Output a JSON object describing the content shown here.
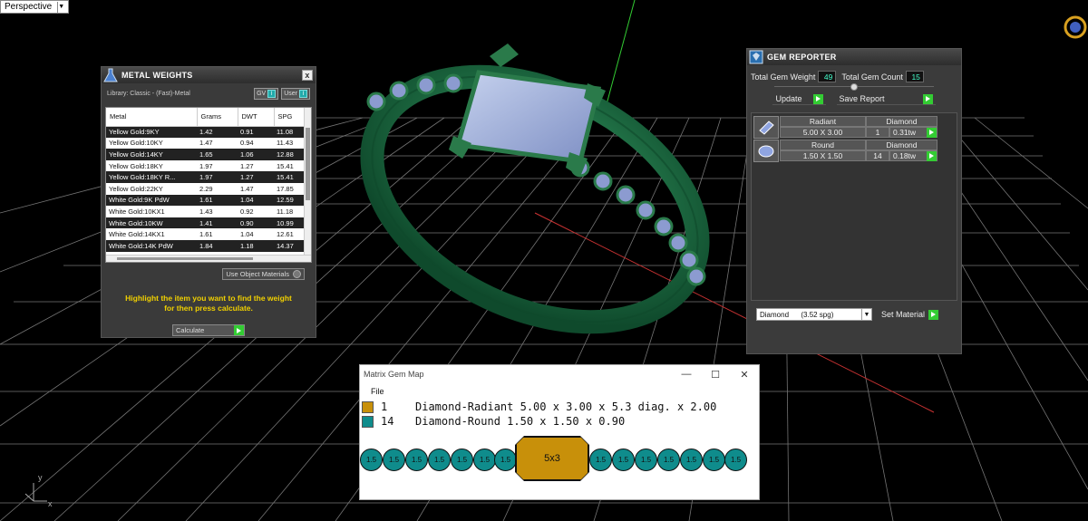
{
  "viewport": {
    "label": "Perspective",
    "axis_y": "y",
    "axis_x": "x"
  },
  "metal_weights": {
    "title": "METAL WEIGHTS",
    "close": "x",
    "library": "Library: Classic - (Fast)-Metal",
    "gv_label": "GV",
    "user_label": "User",
    "columns": [
      "Metal",
      "Grams",
      "DWT",
      "SPG"
    ],
    "rows": [
      [
        "Yellow Gold:9KY",
        "1.42",
        "0.91",
        "11.08"
      ],
      [
        "Yellow Gold:10KY",
        "1.47",
        "0.94",
        "11.43"
      ],
      [
        "Yellow Gold:14KY",
        "1.65",
        "1.06",
        "12.88"
      ],
      [
        "Yellow Gold:18KY",
        "1.97",
        "1.27",
        "15.41"
      ],
      [
        "Yellow Gold:18KY R...",
        "1.97",
        "1.27",
        "15.41"
      ],
      [
        "Yellow Gold:22KY",
        "2.29",
        "1.47",
        "17.85"
      ],
      [
        "White Gold:9K PdW",
        "1.61",
        "1.04",
        "12.59"
      ],
      [
        "White Gold:10KX1",
        "1.43",
        "0.92",
        "11.18"
      ],
      [
        "White Gold:10KW",
        "1.41",
        "0.90",
        "10.99"
      ],
      [
        "White Gold:14KX1",
        "1.61",
        "1.04",
        "12.61"
      ],
      [
        "White Gold:14K PdW",
        "1.84",
        "1.18",
        "14.37"
      ]
    ],
    "use_object_materials": "Use Object Materials",
    "hint_line1": "Highlight the item you want to find the weight",
    "hint_line2": "for then press calculate.",
    "calculate": "Calculate"
  },
  "gem_reporter": {
    "title": "GEM REPORTER",
    "total_weight_label": "Total Gem Weight",
    "total_weight": "49",
    "total_count_label": "Total Gem Count",
    "total_count": "15",
    "update": "Update",
    "save_report": "Save Report",
    "gems": [
      {
        "shape": "Radiant",
        "material": "Diamond",
        "size": "5.00 X 3.00",
        "count": "1",
        "weight": "0.31tw"
      },
      {
        "shape": "Round",
        "material": "Diamond",
        "size": "1.50 X 1.50",
        "count": "14",
        "weight": "0.18tw"
      }
    ],
    "material_select": "Diamond      (3.52 spg)",
    "set_material": "Set Material"
  },
  "gem_map": {
    "title": "Matrix Gem Map",
    "minimize": "—",
    "maximize": "☐",
    "close": "✕",
    "menu_file": "File",
    "lines": [
      {
        "count": "1",
        "desc": "Diamond-Radiant 5.00 x 3.00 x 5.3 diag. x 2.00",
        "color": "#c8900a"
      },
      {
        "count": "14",
        "desc": "Diamond-Round 1.50 x 1.50 x 0.90",
        "color": "#0f8c8c"
      }
    ],
    "small_label": "1.5",
    "big_label": "5x3"
  },
  "colors": {
    "accent_green": "#33cc33",
    "hint_yellow": "#f0d000",
    "teal": "#0f8c8c",
    "gold": "#c8900a"
  }
}
